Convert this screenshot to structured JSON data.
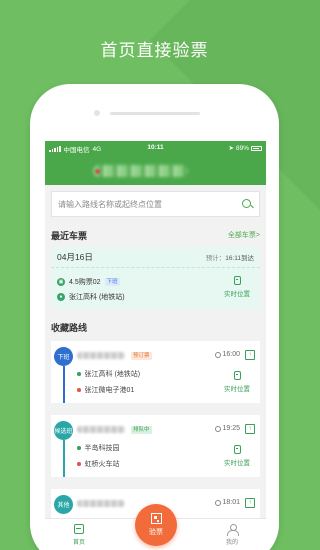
{
  "headline": "首页直接验票",
  "status_bar": {
    "carrier": "中国电信",
    "network": "4G",
    "time": "10:11",
    "battery": "89%"
  },
  "search": {
    "placeholder": "请输入路线名称或起终点位置"
  },
  "recent_tickets": {
    "title": "最近车票",
    "link": "全部车票>",
    "ticket": {
      "date": "04月16日",
      "eta_label": "预计：",
      "eta_time": "16:11到达",
      "line": "4.5购票02",
      "line_tag": "下班",
      "stop": "张江高科 (地铁站)",
      "realtime": "实时位置"
    }
  },
  "favorites": {
    "title": "收藏路线",
    "routes": [
      {
        "badge": "下班",
        "badge_color": "#2f6fcf",
        "tag": "预订票",
        "time": "16:00",
        "stops": [
          "张江高科 (地铁站)",
          "张江微电子港01"
        ],
        "realtime": "实时位置"
      },
      {
        "badge": "候选班",
        "badge_color": "#2aa6a8",
        "tag": "排队中",
        "time": "19:25",
        "stops": [
          "半岛科技园",
          "虹桥火车站"
        ],
        "realtime": "实时位置"
      },
      {
        "badge": "其他",
        "badge_color": "#2aa6a8",
        "tag": "",
        "time": "18:01",
        "stops": [],
        "realtime": ""
      }
    ]
  },
  "tabbar": {
    "home": "首页",
    "scan": "验票",
    "mine": "我的"
  },
  "colors": {
    "brand_green": "#4aa84b",
    "accent_orange": "#f26b3a",
    "background": "#6fbf62"
  }
}
